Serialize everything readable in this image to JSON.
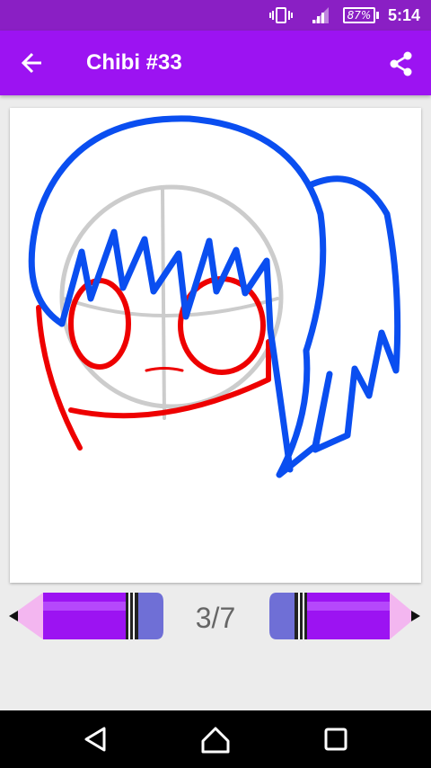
{
  "status_bar": {
    "battery_percent": "87%",
    "time": "5:14",
    "icons": [
      "vibrate-icon",
      "signal-icon",
      "battery-icon"
    ]
  },
  "app_bar": {
    "title": "Chibi #33",
    "back_icon": "arrow-back-icon",
    "share_icon": "share-icon",
    "color": "#9c13f2"
  },
  "drawing": {
    "description_colors": {
      "guide": "#c8c8c8",
      "face_outline": "#ee0000",
      "hair": "#0a4ef0"
    }
  },
  "controls": {
    "step_counter": "3/7",
    "prev_icon": "pencil-left-icon",
    "next_icon": "pencil-right-icon"
  },
  "nav_bar": {
    "icons": [
      "back-triangle-icon",
      "home-icon",
      "recents-icon"
    ]
  }
}
